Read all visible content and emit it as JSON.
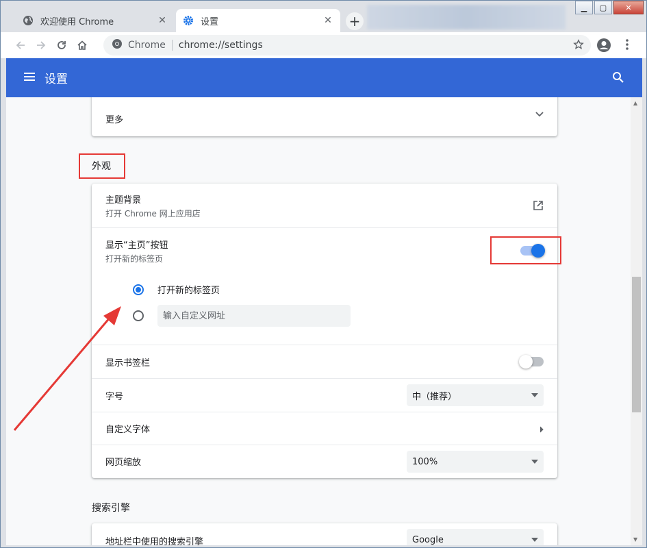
{
  "tabs": [
    {
      "title": "欢迎使用 Chrome",
      "active": false
    },
    {
      "title": "设置",
      "active": true
    }
  ],
  "omnibox": {
    "scheme_label": "Chrome",
    "url": "chrome://settings"
  },
  "header": {
    "title": "设置"
  },
  "sections": {
    "more": {
      "label": "更多"
    },
    "appearance": {
      "title": "外观",
      "theme": {
        "label": "主题背景",
        "sub": "打开 Chrome 网上应用店"
      },
      "home_button": {
        "label": "显示“主页”按钮",
        "sub": "打开新的标签页",
        "enabled": true
      },
      "home_options": {
        "new_tab_label": "打开新的标签页",
        "custom_url_placeholder": "输入自定义网址"
      },
      "bookmarks_bar": {
        "label": "显示书签栏",
        "enabled": false
      },
      "font_size": {
        "label": "字号",
        "value": "中（推荐）"
      },
      "custom_fonts": {
        "label": "自定义字体"
      },
      "page_zoom": {
        "label": "网页缩放",
        "value": "100%"
      }
    },
    "search_engine": {
      "title": "搜索引擎",
      "row_label": "地址栏中使用的搜索引擎",
      "value": "Google"
    }
  },
  "colors": {
    "header": "#3367d6",
    "accent": "#1a73e8",
    "annotation": "#e53935"
  }
}
